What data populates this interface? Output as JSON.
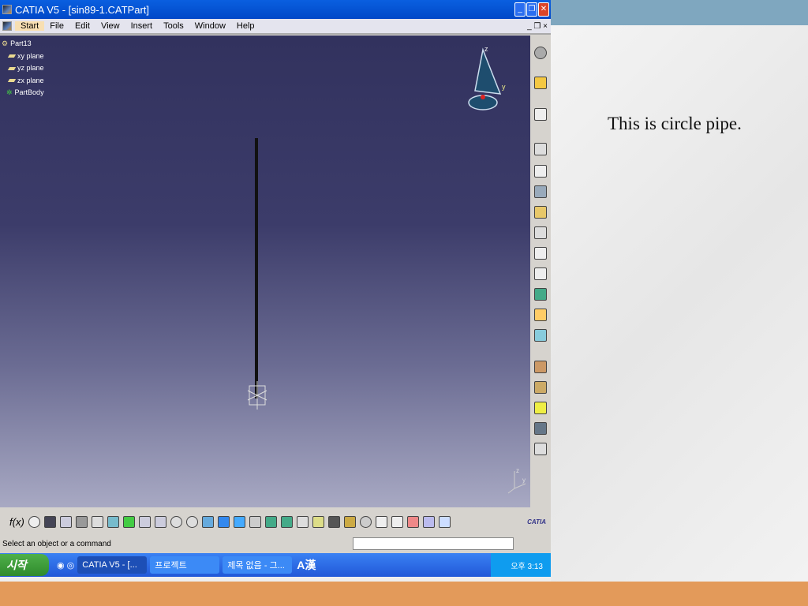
{
  "window": {
    "title": "CATIA V5 - [sin89-1.CATPart]",
    "menu": [
      "Start",
      "File",
      "Edit",
      "View",
      "Insert",
      "Tools",
      "Window",
      "Help"
    ]
  },
  "tree": {
    "root": "Part13",
    "items": [
      "xy plane",
      "yz plane",
      "zx plane",
      "PartBody"
    ]
  },
  "status": {
    "text": "Select an object or a command",
    "brand": "CATIA"
  },
  "taskbar": {
    "start": "시작",
    "tasks": [
      "CATIA V5 - [...",
      "프로젝트",
      "제목 없음 - 그..."
    ],
    "ime": "A漢",
    "clock": "오후 3:13"
  },
  "slide": {
    "caption": "This is circle pipe."
  }
}
